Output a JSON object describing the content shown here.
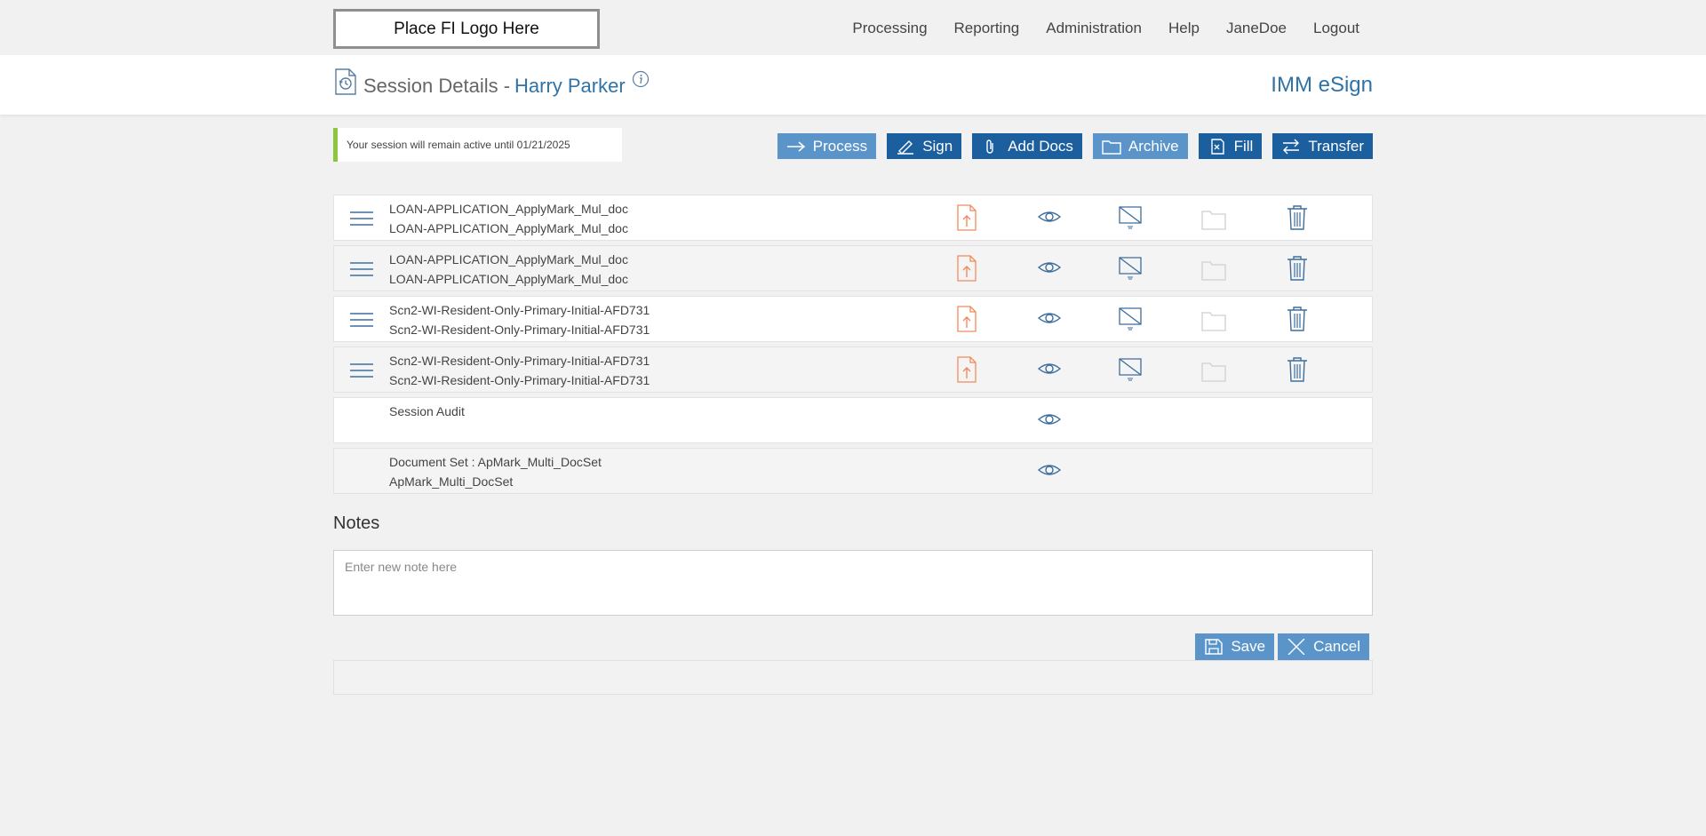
{
  "header": {
    "logo_text": "Place FI Logo Here",
    "nav": [
      "Processing",
      "Reporting",
      "Administration",
      "Help",
      "JaneDoe",
      "Logout"
    ]
  },
  "session": {
    "title_label": "Session Details -",
    "customer_name": "Harry Parker",
    "brand": "IMM eSign",
    "status_note": "Your session will remain active until 01/21/2025"
  },
  "actions": {
    "process": "Process",
    "sign": "Sign",
    "add_docs": "Add Docs",
    "archive": "Archive",
    "fill": "Fill",
    "transfer": "Transfer"
  },
  "documents": [
    {
      "line1": "LOAN-APPLICATION_ApplyMark_Mul_doc",
      "line2": "LOAN-APPLICATION_ApplyMark_Mul_doc"
    },
    {
      "line1": "LOAN-APPLICATION_ApplyMark_Mul_doc",
      "line2": "LOAN-APPLICATION_ApplyMark_Mul_doc"
    },
    {
      "line1": "Scn2-WI-Resident-Only-Primary-Initial-AFD731",
      "line2": "Scn2-WI-Resident-Only-Primary-Initial-AFD731"
    },
    {
      "line1": "Scn2-WI-Resident-Only-Primary-Initial-AFD731",
      "line2": "Scn2-WI-Resident-Only-Primary-Initial-AFD731"
    }
  ],
  "audit": {
    "line1": "Session Audit"
  },
  "doc_set": {
    "line1": "Document Set : ApMark_Multi_DocSet",
    "line2": "ApMark_Multi_DocSet"
  },
  "notes": {
    "title": "Notes",
    "placeholder": "Enter new note here",
    "save": "Save",
    "cancel": "Cancel"
  },
  "colors": {
    "accent": "#1b5f9e",
    "accent_light": "#5a94c8",
    "link": "#2f73a7",
    "upload_icon": "#f08a5d",
    "status_bar": "#8cc63f"
  }
}
